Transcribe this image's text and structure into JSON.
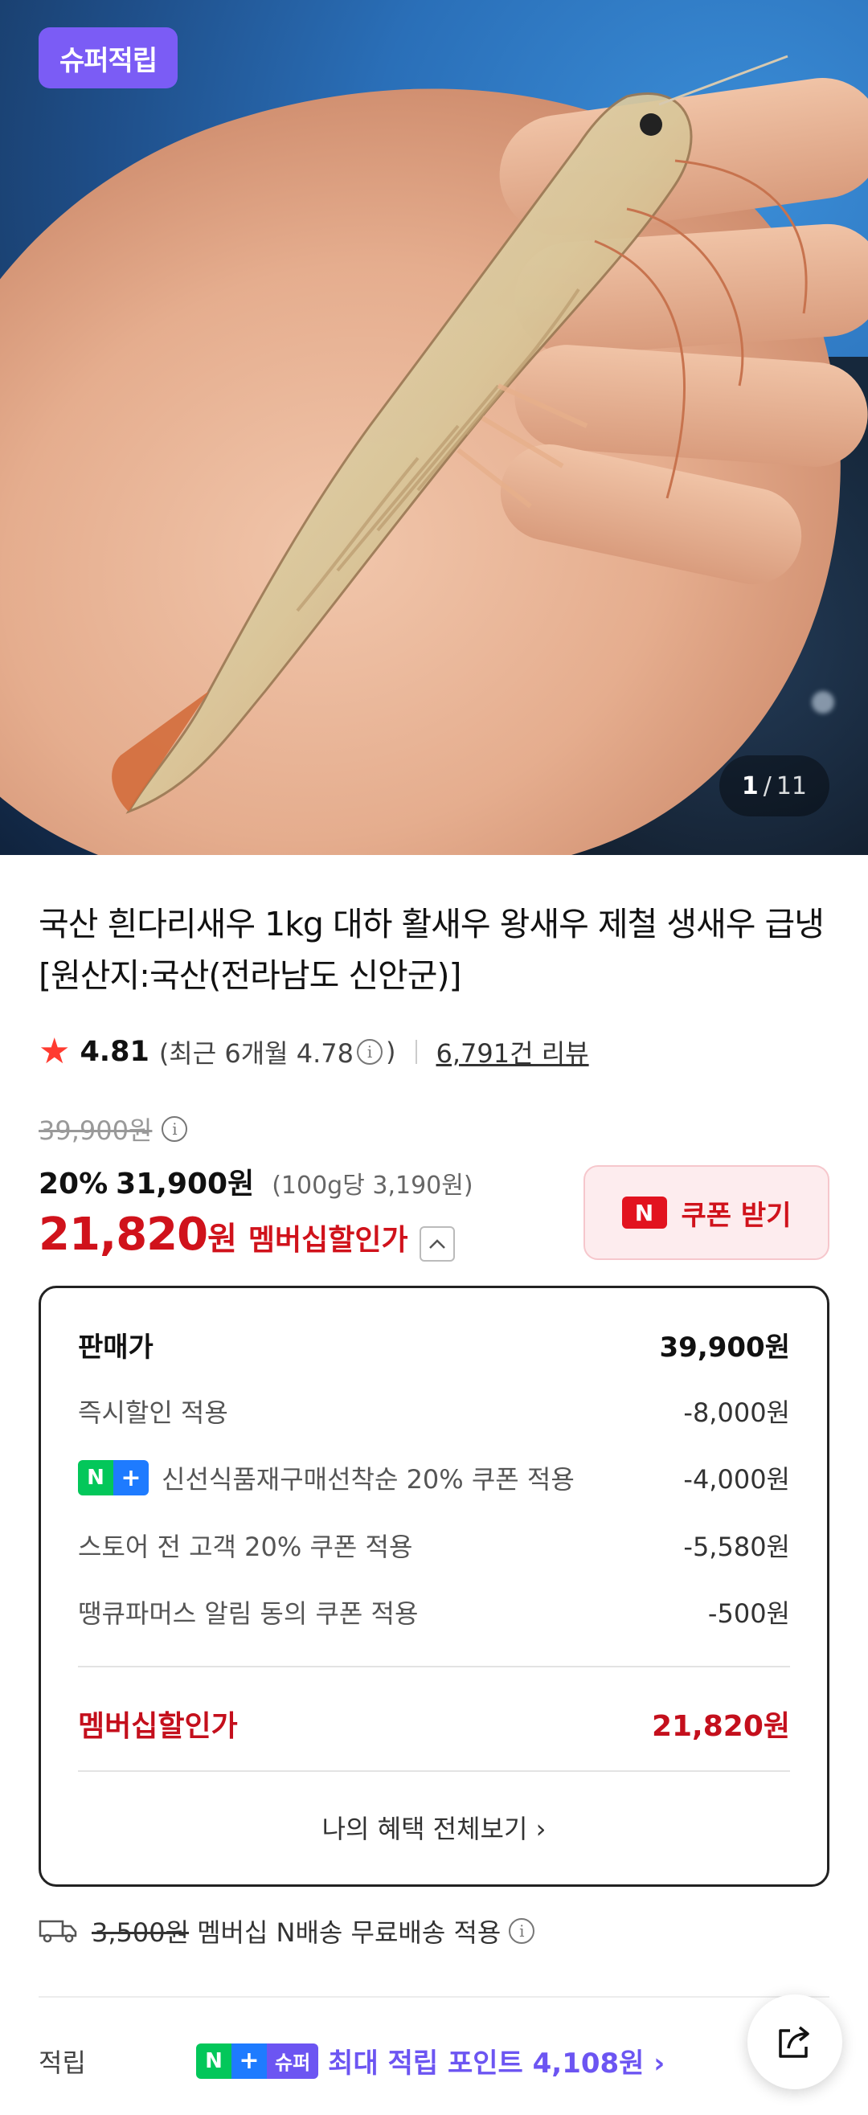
{
  "hero": {
    "badge": "슈퍼적립",
    "pager_current": "1",
    "pager_separator": "/",
    "pager_total": "11"
  },
  "product": {
    "title": "국산 흰다리새우 1kg 대하 활새우 왕새우 제철 생새우 급냉 [원산지:국산(전라남도 신안군)]",
    "rating": "4.81",
    "rating_recent_prefix": "(최근 6개월 4.78",
    "rating_recent_suffix": ")",
    "review_count": "6,791건 리뷰"
  },
  "price": {
    "original": "39,900원",
    "discount_pct": "20%",
    "sale_price": "31,900원",
    "unit_price": "(100g당 3,190원)",
    "member_price": "21,820",
    "member_won": "원",
    "member_label": "멤버십할인가",
    "coupon_button": "쿠폰 받기",
    "coupon_logo": "N"
  },
  "breakdown": {
    "rows": [
      {
        "label": "판매가",
        "value": "39,900원"
      },
      {
        "label": "즉시할인 적용",
        "value": "-8,000원"
      },
      {
        "label": "신선식품재구매선착순 20% 쿠폰 적용",
        "value": "-4,000원"
      },
      {
        "label": "스토어 전 고객 20% 쿠폰 적용",
        "value": "-5,580원"
      },
      {
        "label": "땡큐파머스 알림 동의 쿠폰 적용",
        "value": "-500원"
      }
    ],
    "total_label": "멤버십할인가",
    "total_value": "21,820원",
    "view_all": "나의 혜택 전체보기 ›",
    "np_n": "N",
    "np_plus": "+"
  },
  "shipping": {
    "fee": "3,500원",
    "text": "멤버십 N배송 무료배송 적용"
  },
  "points": {
    "label": "적립",
    "super": "슈퍼",
    "text": "최대 적립 포인트 4,108원 ›"
  },
  "colors": {
    "accent_red": "#d0121b",
    "super_purple": "#6c55f2",
    "naver_green": "#03c75a",
    "plus_blue": "#1e7bff"
  }
}
